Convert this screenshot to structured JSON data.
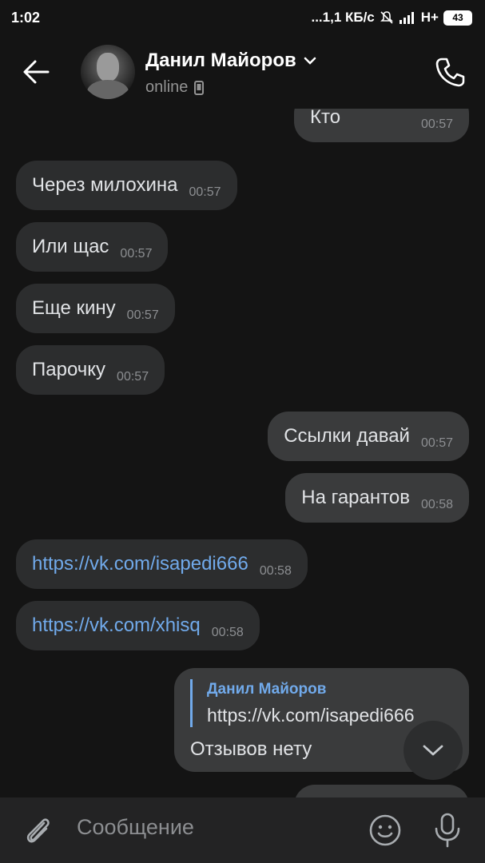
{
  "status_bar": {
    "time": "1:02",
    "speed": "...1,1 КБ/с",
    "network": "H+",
    "battery": "43"
  },
  "header": {
    "contact_name": "Данил Майоров",
    "contact_status": "online"
  },
  "messages": [
    {
      "dir": "out",
      "text": "Кто",
      "time": "00:57"
    },
    {
      "dir": "in",
      "text": "Через милохина",
      "time": "00:57"
    },
    {
      "dir": "in",
      "text": "Или щас",
      "time": "00:57"
    },
    {
      "dir": "in",
      "text": "Еще кину",
      "time": "00:57"
    },
    {
      "dir": "in",
      "text": "Парочку",
      "time": "00:57"
    },
    {
      "dir": "out",
      "text": "Ссылки давай",
      "time": "00:57"
    },
    {
      "dir": "out",
      "text": "На гарантов",
      "time": "00:58"
    },
    {
      "dir": "in",
      "text": "https://vk.com/isapedi666",
      "time": "00:58",
      "link": true
    },
    {
      "dir": "in",
      "text": "https://vk.com/xhisq",
      "time": "00:58",
      "link": true
    }
  ],
  "reply": {
    "author": "Данил Майоров",
    "quote": "https://vk.com/isapedi666",
    "text": "Отзывов нету"
  },
  "composer": {
    "placeholder": "Сообщение"
  },
  "colors": {
    "background": "#141414",
    "bubble_in": "#2c2d2e",
    "bubble_out": "#3a3b3c",
    "link": "#71aaeb"
  }
}
